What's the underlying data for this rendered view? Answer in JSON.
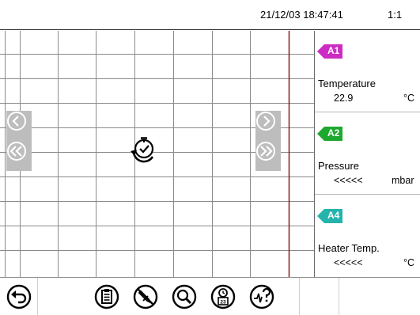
{
  "header": {
    "datetime": "21/12/03 18:47:41",
    "zoom": "1:1"
  },
  "chart": {
    "grid": true,
    "nav_left_icons": [
      "scroll-back-icon",
      "scroll-back-fast-icon"
    ],
    "nav_right_icons": [
      "scroll-forward-icon",
      "scroll-forward-fast-icon"
    ],
    "center_icon": "time-jump-icon",
    "cursor_line_color": "#8b1a1a",
    "grid_color": "#808080"
  },
  "channels": [
    {
      "tag": "A1",
      "color": "#cc2bc4",
      "name": "Temperature",
      "value": "22.9",
      "unit": "°C"
    },
    {
      "tag": "A2",
      "color": "#1fa82f",
      "name": "Pressure",
      "value": "<<<<<",
      "unit": "mbar"
    },
    {
      "tag": "A4",
      "color": "#25b4ac",
      "name": "Heater Temp.",
      "value": "<<<<<",
      "unit": "°C"
    }
  ],
  "toolbar": {
    "icons": [
      "back-icon",
      "clipboard-icon",
      "no-edit-icon",
      "search-icon",
      "calendar-clock-icon",
      "signal-help-icon"
    ]
  }
}
